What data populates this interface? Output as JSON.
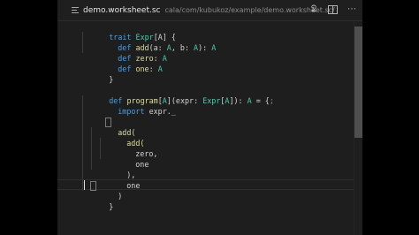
{
  "tab": {
    "title": "demo.worksheet.sc",
    "path": "cala/com/kubukoz/example/demo.worksheet.sc/"
  },
  "toolbar": {
    "actions": [
      {
        "name": "run-worksheet-icon",
        "glyph": "ᘖ"
      },
      {
        "name": "split-editor-icon",
        "glyph": ""
      },
      {
        "name": "more-actions-icon",
        "glyph": "⋯"
      }
    ]
  },
  "code": {
    "l1": {
      "kw": "trait",
      "ty": "Expr",
      "rest": "[A] {"
    },
    "l2": {
      "kw": "def",
      "fn": "add",
      "p1": "(a: ",
      "t1": "A",
      "p2": ", b: ",
      "t2": "A",
      "p3": "): ",
      "t3": "A"
    },
    "l3": {
      "kw": "def",
      "fn": "zero",
      "p1": ": ",
      "t1": "A"
    },
    "l4": {
      "kw": "def",
      "fn": "one",
      "p1": ": ",
      "t1": "A"
    },
    "l5": "}",
    "l6": {
      "kw": "def",
      "fn": "program",
      "p1": "[",
      "t1": "A",
      "p2": "](expr: ",
      "t2": "Expr",
      "p3": "[",
      "t3": "A",
      "p4": "]): ",
      "t4": "A",
      "p5": " = {",
      "p6": ";"
    },
    "l7": {
      "kw": "import",
      "rest": "expr._"
    },
    "l8": {
      "text": "add("
    },
    "l9": {
      "text": "add("
    },
    "l10": {
      "text": "zero,"
    },
    "l11": {
      "text": "one"
    },
    "l12": {
      "text": "),"
    },
    "l13": {
      "text": "one"
    },
    "l14": {
      "text": ")"
    },
    "l15": "}"
  },
  "colors": {
    "keyword": "#569cd6",
    "type": "#4ec9b0",
    "function": "#dcdcaa",
    "text": "#d4d4d4",
    "background": "#1e1e1e"
  }
}
